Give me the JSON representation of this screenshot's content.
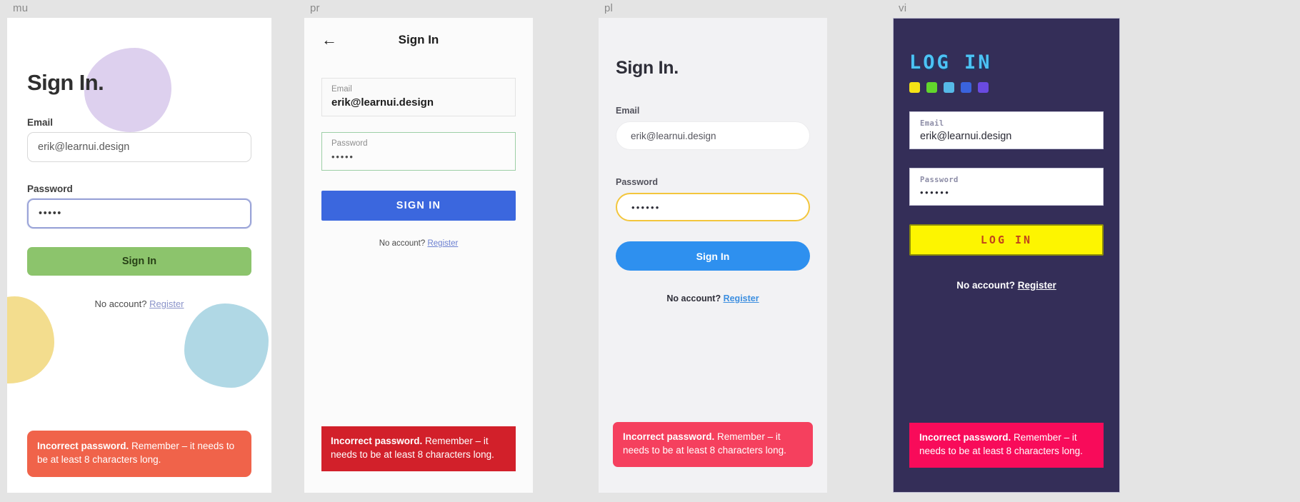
{
  "common": {
    "email_label": "Email",
    "password_label": "Password",
    "email_value": "erik@learnui.design",
    "password_value": "•••••",
    "password_value_6": "••••••",
    "no_account_text": "No account?",
    "register_label": "Register",
    "error_bold": "Incorrect password.",
    "error_rest": " Remember – it needs to be at least 8 characters long."
  },
  "panels": [
    {
      "tag": "mu",
      "title": "Sign In.",
      "button_label": "Sign In",
      "accent": "#8cc46c",
      "error_color": "#f0634a",
      "focus_color": "#9aa4d8",
      "bg": "#ffffff",
      "blobs": [
        {
          "name": "purple",
          "color": "#ddd0ee"
        },
        {
          "name": "yellow",
          "color": "#f3dd8e"
        },
        {
          "name": "blue",
          "color": "#b0d8e5"
        }
      ]
    },
    {
      "tag": "pr",
      "appbar_title": "Sign In",
      "back_icon": "back-arrow-icon",
      "button_label": "SIGN IN",
      "accent": "#3b67de",
      "error_color": "#d2202a",
      "focus_color": "#9dcfa6",
      "bg": "#fbfbfb"
    },
    {
      "tag": "pl",
      "title": "Sign In.",
      "button_label": "Sign In",
      "accent": "#2e90ef",
      "error_color": "#f5405e",
      "focus_color": "#f3c63c",
      "bg": "#f2f2f4"
    },
    {
      "tag": "vi",
      "title": "LOG IN",
      "button_label": "LOG IN",
      "accent": "#fdf500",
      "error_color": "#f80b5a",
      "bg": "#342e58",
      "title_color": "#4cc3f5",
      "swatches": [
        "#f5e216",
        "#62d62c",
        "#56b9e8",
        "#3a63dd",
        "#6a4ae0"
      ]
    }
  ]
}
